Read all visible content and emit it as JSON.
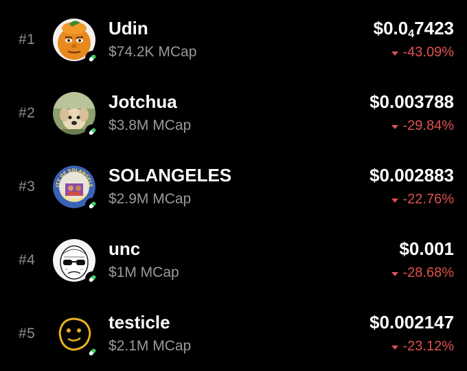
{
  "colors": {
    "background": "#000000",
    "negative": "#e0524f",
    "pill_green": "#3ed06a"
  },
  "tokens": [
    {
      "rank": "#1",
      "name": "Udin",
      "mcap": "$74.2K MCap",
      "price_prefix": "$0.0",
      "price_sub": "4",
      "price_suffix": "7423",
      "change": "-43.09%",
      "avatar_icon": "orange-face-avatar"
    },
    {
      "rank": "#2",
      "name": "Jotchua",
      "mcap": "$3.8M MCap",
      "price_prefix": "$0.003788",
      "price_sub": "",
      "price_suffix": "",
      "change": "-29.84%",
      "avatar_icon": "dog-avatar"
    },
    {
      "rank": "#3",
      "name": "SOLANGELES",
      "mcap": "$2.9M MCap",
      "price_prefix": "$0.002883",
      "price_sub": "",
      "price_suffix": "",
      "change": "-22.76%",
      "avatar_icon": "city-badge-avatar",
      "avatar_text_top": "CITY OF SOLANGELES",
      "avatar_text_bottom": "STATE OF MEME"
    },
    {
      "rank": "#4",
      "name": "unc",
      "mcap": "$1M MCap",
      "price_prefix": "$0.001",
      "price_sub": "",
      "price_suffix": "",
      "change": "-28.68%",
      "avatar_icon": "sunglasses-face-avatar"
    },
    {
      "rank": "#5",
      "name": "testicle",
      "mcap": "$2.1M MCap",
      "price_prefix": "$0.002147",
      "price_sub": "",
      "price_suffix": "",
      "change": "-23.12%",
      "avatar_icon": "doodle-face-avatar"
    }
  ]
}
